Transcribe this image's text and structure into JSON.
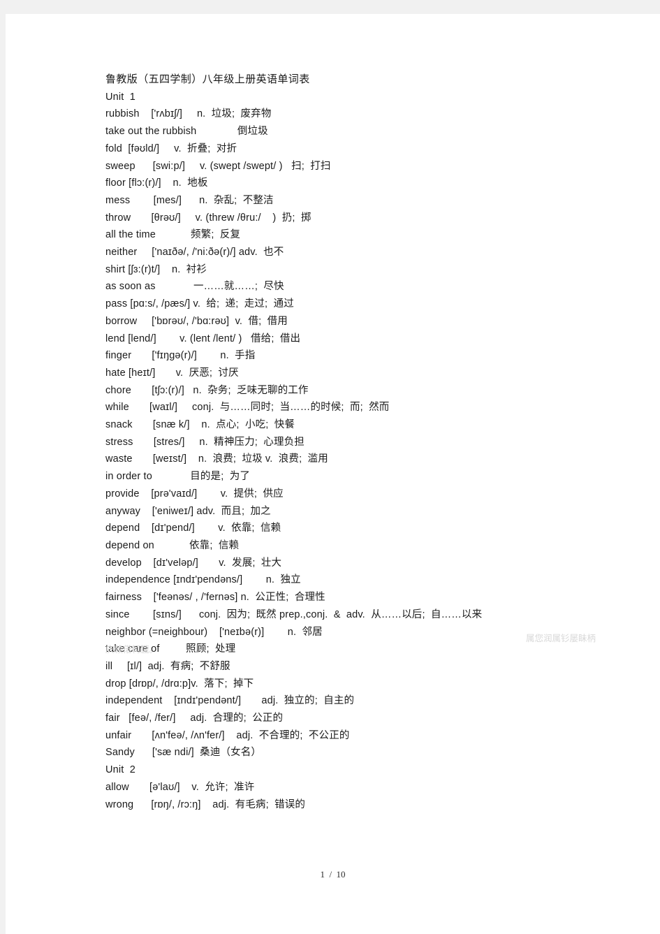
{
  "document": {
    "title": "鲁教版（五四学制）八年级上册英语单词表",
    "footer": "1  /  10",
    "ghost_artifact_tail": "属您润属钐屡眛柄",
    "ghost_artifact_wrap": "庆赖偌軻朧。",
    "lines": [
      "Unit  1",
      "rubbish    ['rʌbɪʃ/]     n.  垃圾;  废弃物",
      "take out the rubbish              倒垃圾",
      "fold  [fəʊld/]     v.  折叠;  对折",
      "sweep      [swi:p/]     v. (swept /swept/ )   扫;  打扫",
      "floor [flɔ:(r)/]    n.  地板",
      "mess        [mes/]      n.  杂乱;  不整洁",
      "throw       [θrəʊ/]     v. (threw /θru:/    )  扔;  掷",
      "all the time            频繁;  反复",
      "neither     ['naɪðə/, /'ni:ðə(r)/] adv.  也不",
      "shirt [ʃɜ:(r)t/]    n.  衬衫",
      "as soon as             一……就……;  尽快",
      "pass [pɑ:s/, /pæs/] v.  给;  递;  走过;  通过",
      "borrow     ['bɒrəʊ/, /'bɑ:rəʊ]  v.  借;  借用",
      "lend [lend/]        v. (lent /lent/ )   借给;  借出",
      "finger       ['fɪŋgə(r)/]        n.  手指",
      "hate [heɪt/]       v.  厌恶;  讨厌",
      "chore       [tʃɔ:(r)/]   n.  杂务;  乏味无聊的工作",
      "while       [waɪl/]     conj.  与……同时;  当……的时候;  而;  然而",
      "snack       [snæ k/]    n.  点心;  小吃;  快餐",
      "stress       [stres/]     n.  精神压力;  心理负担",
      "waste       [weɪst/]    n.  浪费;  垃圾 v.  浪费;  滥用",
      "in order to             目的是;  为了",
      "provide    [prə'vaɪd/]        v.  提供;  供应",
      "anyway    ['eniweɪ/] adv.  而且;  加之",
      "depend    [dɪ'pend/]        v.  依靠;  信赖",
      "depend on            依靠;  信赖",
      "develop    [dɪ'veləp/]       v.  发展;  壮大",
      "independence [ɪndɪ'pendəns/]        n.  独立",
      "fairness    ['feənəs/ , /'fernəs] n.  公正性;  合理性",
      "since        [sɪns/]      conj.  因为;  既然 prep.,conj.  &  adv.  从……以后;  自……以来",
      "",
      "neighbor (=neighbour)    ['neɪbə(r)]        n.  邻居",
      "take care of         照顾;  处理",
      "ill     [ɪl/]  adj.  有病;  不舒服",
      "drop [drɒp/, /drɑ:p]v.  落下;  掉下",
      "independent    [ɪndɪ'pendənt/]       adj.  独立的;  自主的",
      "fair   [feə/, /fer/]     adj.  合理的;  公正的",
      "unfair       [ʌn'feə/, /ʌn'fer/]    adj.  不合理的;  不公正的",
      "Sandy      ['sæ ndi/]  桑迪（女名）",
      "Unit  2",
      "allow       [ə'laʊ/]    v.  允许;  准许",
      "wrong      [rɒŋ/, /rɔ:ŋ]    adj.  有毛病;  错误的"
    ]
  }
}
